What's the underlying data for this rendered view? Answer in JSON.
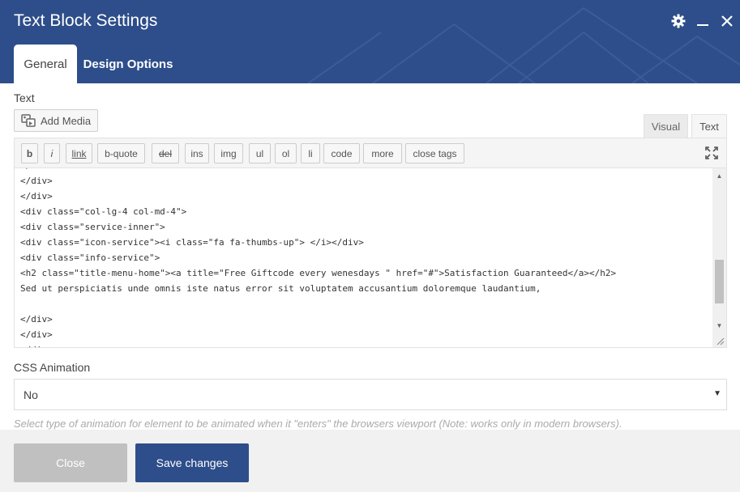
{
  "header": {
    "title": "Text Block Settings",
    "background_color": "#2d4e8a",
    "icons": [
      "gear-icon",
      "minimize-icon",
      "close-icon"
    ]
  },
  "tabs": [
    {
      "label": "General",
      "active": true
    },
    {
      "label": "Design Options",
      "active": false
    }
  ],
  "text_field": {
    "label": "Text",
    "add_media_label": "Add Media",
    "mode_tabs": [
      {
        "label": "Visual",
        "active": false
      },
      {
        "label": "Text",
        "active": true
      }
    ],
    "toolbar_buttons": [
      "b",
      "i",
      "link",
      "b-quote",
      "del",
      "ins",
      "img",
      "ul",
      "ol",
      "li",
      "code",
      "more",
      "close tags"
    ],
    "code_lines": [
      "</div>",
      "</div>",
      "</div>",
      "<div class=\"col-lg-4 col-md-4\">",
      "<div class=\"service-inner\">",
      "<div class=\"icon-service\"><i class=\"fa fa-thumbs-up\"> </i></div>",
      "<div class=\"info-service\">",
      "<h2 class=\"title-menu-home\"><a title=\"Free Giftcode every wenesdays \" href=\"#\">Satisfaction Guaranteed</a></h2>",
      "Sed ut perspiciatis unde omnis iste natus error sit voluptatem accusantium doloremque laudantium,",
      "",
      "</div>",
      "</div>",
      "</div>"
    ]
  },
  "css_animation": {
    "label": "CSS Animation",
    "selected": "No",
    "help": "Select type of animation for element to be animated when it \"enters\" the browsers viewport (Note: works only in modern browsers)."
  },
  "footer": {
    "close_label": "Close",
    "save_label": "Save changes",
    "save_color": "#2d4e8a",
    "close_color": "#c0c0c0"
  }
}
